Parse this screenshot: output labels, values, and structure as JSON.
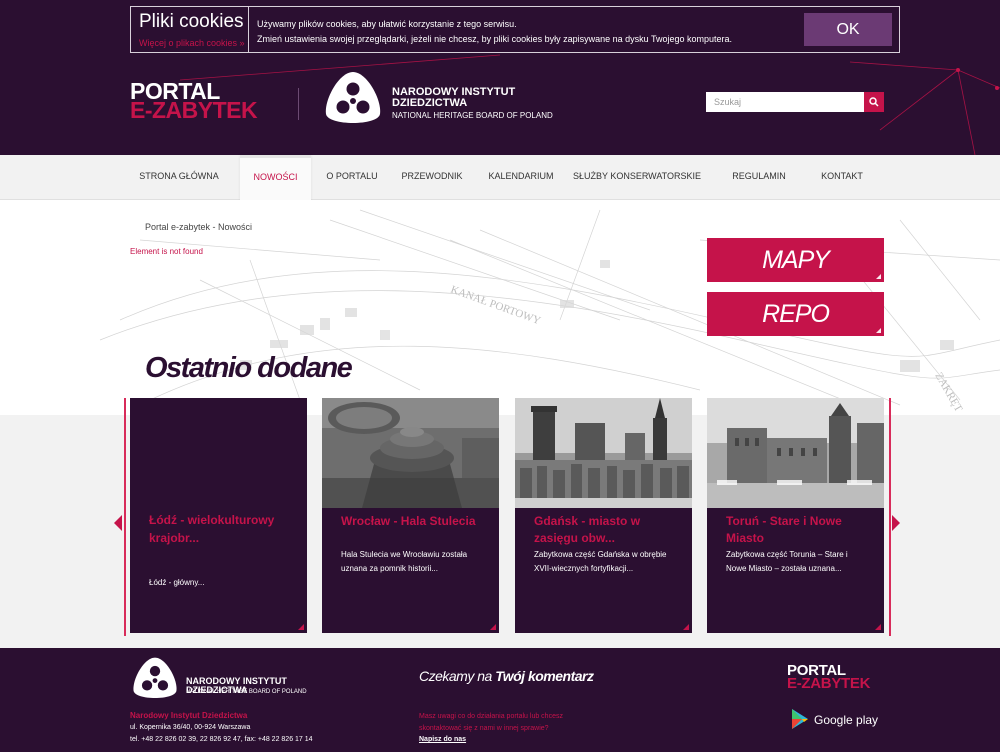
{
  "cookie": {
    "title": "Pliki cookies",
    "more_link": "Więcej o plikach cookies »",
    "line1": "Używamy plików cookies, aby ułatwić korzystanie z tego serwisu.",
    "line2": "Zmień ustawienia swojej przeglądarki, jeżeli nie chcesz, by pliki cookies były zapisywane na dysku Twojego komputera.",
    "ok_label": "OK"
  },
  "header": {
    "portal_line1": "PORTAL",
    "portal_line2": "E-ZABYTEK",
    "nid_name_line1": "NARODOWY INSTYTUT",
    "nid_name_line2": "DZIEDZICTWA",
    "nid_sub": "NATIONAL HERITAGE BOARD OF POLAND",
    "search_placeholder": "Szukaj"
  },
  "nav": {
    "items": [
      {
        "label": "STRONA GŁÓWNA"
      },
      {
        "label": "NOWOŚCI"
      },
      {
        "label": "O PORTALU"
      },
      {
        "label": "PRZEWODNIK"
      },
      {
        "label": "KALENDARIUM"
      },
      {
        "label": "SŁUŻBY KONSERWATORSKIE"
      },
      {
        "label": "REGULAMIN"
      },
      {
        "label": "KONTAKT"
      }
    ],
    "active_index": 1
  },
  "main": {
    "breadcrumb": "Portal e-zabytek - Nowości",
    "error": "Element is not found",
    "promo_maps": "MAPY",
    "promo_repo": "REPO",
    "section_title": "Ostatnio dodane"
  },
  "cards": [
    {
      "title": "Łódź - wielokulturowy krajobr...",
      "desc": "Łódź - główny..."
    },
    {
      "title": "Wrocław - Hala Stulecia",
      "desc": "Hala Stulecia we Wrocławiu została uznana za pomnik historii..."
    },
    {
      "title": "Gdańsk - miasto w zasięgu obw...",
      "desc": "Zabytkowa część Gdańska w obrębie XVII-wiecznych fortyfikacji..."
    },
    {
      "title": "Toruń - Stare i Nowe Miasto",
      "desc": "Zabytkowa część Torunia – Stare i Nowe Miasto – została uznana..."
    }
  ],
  "footer": {
    "nid_name_line1": "NARODOWY INSTYTUT",
    "nid_name_line2": "DZIEDZICTWA",
    "nid_sub": "NATIONAL HERITAGE BOARD OF POLAND",
    "org": "Narodowy Instytut Dziedzictwa",
    "address": "ul. Kopernika 36/40, 00-924 Warszawa",
    "phone": "tel. +48 22 826 02 39, 22 826 92 47, fax: +48 22 826 17 14",
    "comment_prefix": "Czekamy na",
    "comment_bold": "Twój komentarz",
    "note": "Masz uwagi co do działania portalu lub chcesz skontaktować się z nami w innej sprawie?",
    "write": "Napisz do nas",
    "portal_line1": "PORTAL",
    "portal_line2": "E-ZABYTEK",
    "google_play": "Google play"
  },
  "colors": {
    "accent": "#c5134a",
    "dark": "#2b0f31"
  }
}
